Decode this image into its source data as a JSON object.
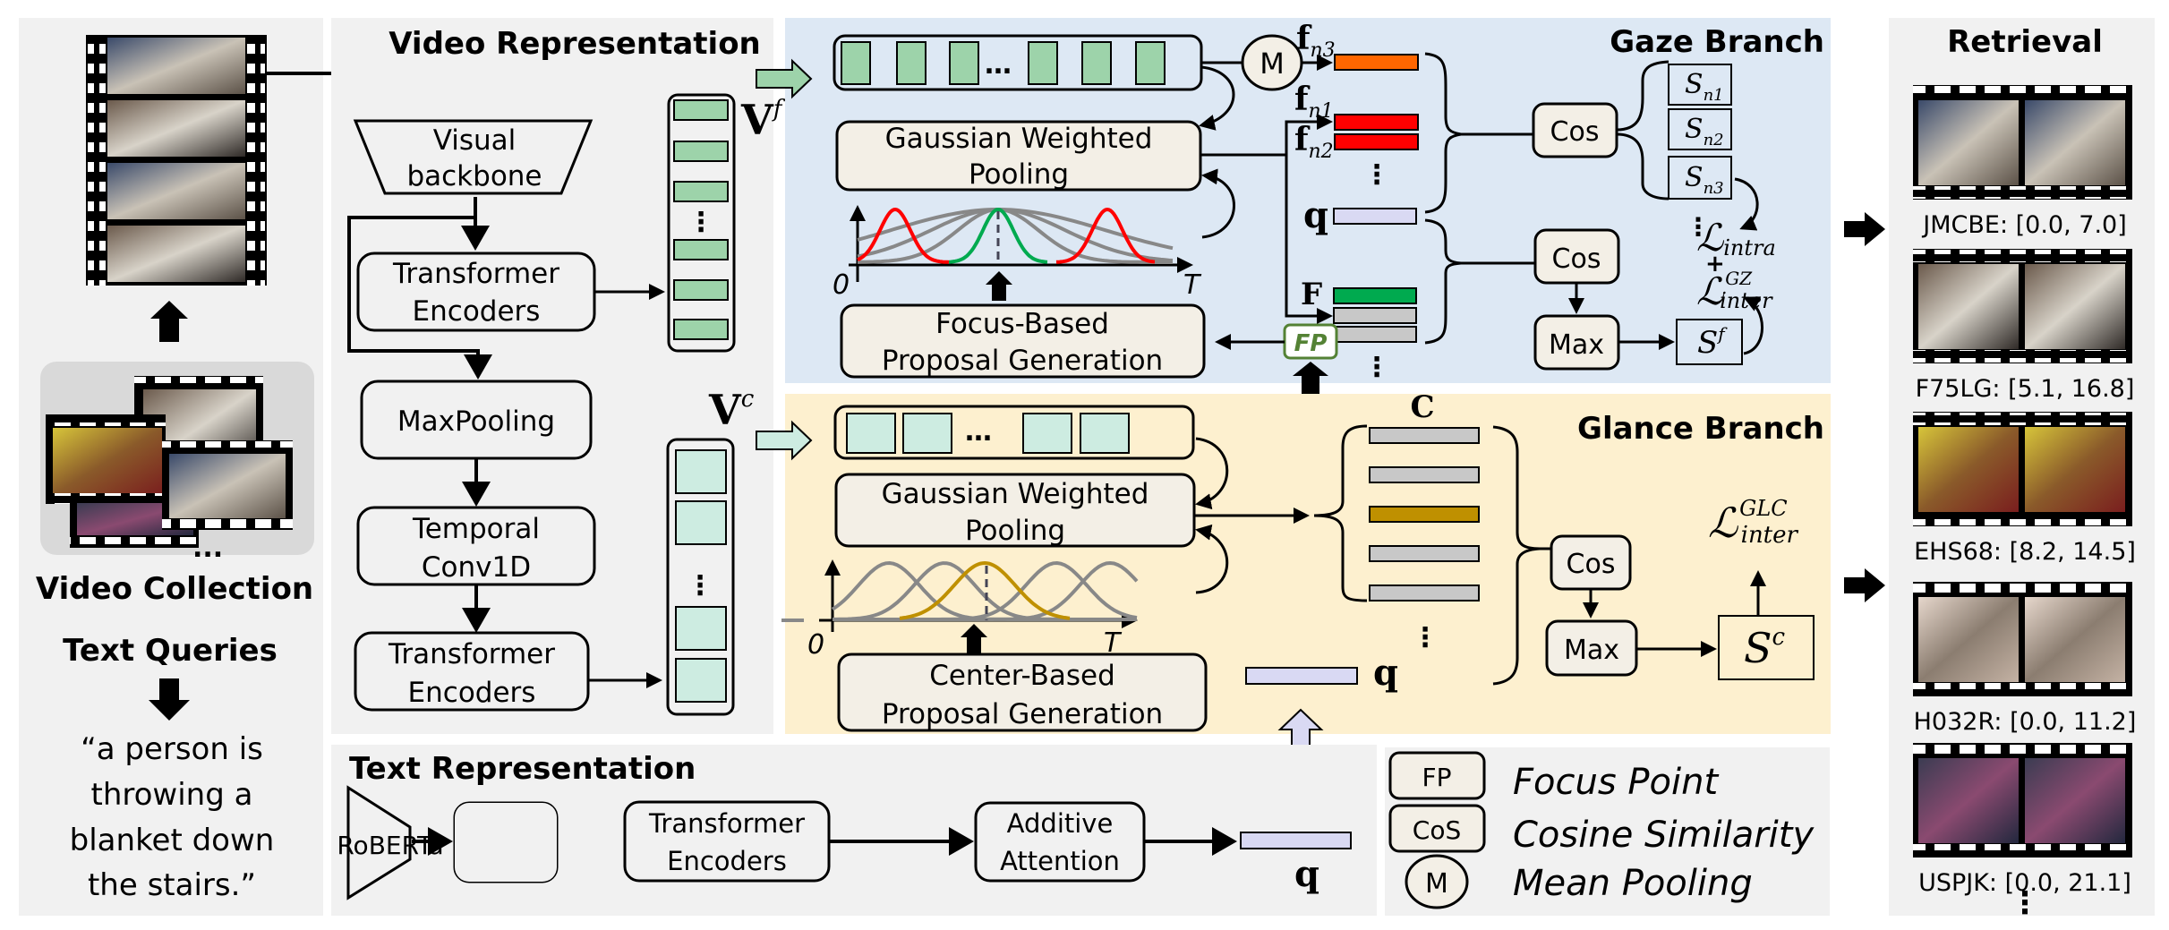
{
  "colors": {
    "panel_gray": "#f1f1f1",
    "gaze_bg": "#dde8f4",
    "glance_bg": "#fdf0cf",
    "feature_green": "#9dd3aa",
    "feature_teal": "#cdece1",
    "query_lavender": "#d9d9f3",
    "red": "#ff0000",
    "orange": "#ff6600",
    "green": "#00aa4f",
    "gray_bar": "#c8c8c8",
    "gold": "#bf9000",
    "fp_green": "#548235"
  },
  "video_collection": {
    "title": "Video Collection",
    "more": "..."
  },
  "text_queries": {
    "title": "Text Queries",
    "query_lines": [
      "“a person is",
      "throwing a",
      "blanket down",
      "the stairs.”"
    ]
  },
  "video_representation": {
    "title": "Video Representation",
    "visual_backbone": [
      "Visual",
      "backbone"
    ],
    "transformer_encoders_1": [
      "Transformer",
      "Encoders"
    ],
    "maxpooling": "MaxPooling",
    "temporal_conv": [
      "Temporal",
      "Conv1D"
    ],
    "transformer_encoders_2": [
      "Transformer",
      "Encoders"
    ],
    "vf_label": "V",
    "vf_sup": "f",
    "vc_label": "V",
    "vc_sup": "c"
  },
  "gaze_branch": {
    "title": "Gaze Branch",
    "gwp": [
      "Gaussian Weighted",
      "Pooling"
    ],
    "proposal": [
      "Focus-Based",
      "Proposal Generation"
    ],
    "axis_origin": "0",
    "axis_end": "T",
    "mean_pool": "M",
    "fn3": "f",
    "fn3_sub": "n3",
    "fn1": "f",
    "fn1_sub": "n1",
    "fn2": "f",
    "fn2_sub": "n2",
    "q": "q",
    "F": "F",
    "fp": "FP",
    "cos1": "Cos",
    "cos2": "Cos",
    "max": "Max",
    "sn1": "S",
    "sn1_sub": "n1",
    "sn2": "S",
    "sn2_sub": "n2",
    "sn3": "S",
    "sn3_sub": "n3",
    "loss_intra": "ℒ",
    "loss_intra_sub": "intra",
    "plus": "+",
    "loss_inter": "ℒ",
    "loss_inter_sup": "GZ",
    "loss_inter_sub": "inter",
    "sf": "S",
    "sf_sup": "f"
  },
  "glance_branch": {
    "title": "Glance Branch",
    "gwp": [
      "Gaussian Weighted",
      "Pooling"
    ],
    "proposal": [
      "Center-Based",
      "Proposal Generation"
    ],
    "axis_origin": "0",
    "axis_end": "T",
    "C": "C",
    "q": "q",
    "cos": "Cos",
    "max": "Max",
    "loss": "ℒ",
    "loss_sup": "GLC",
    "loss_sub": "inter",
    "sc": "S",
    "sc_sup": "c"
  },
  "text_representation": {
    "title": "Text Representation",
    "roberta": "RoBERTa",
    "transformer": [
      "Transformer",
      "Encoders"
    ],
    "additive": [
      "Additive",
      "Attention"
    ],
    "q": "q"
  },
  "legend": {
    "items": [
      {
        "symbol": "FP",
        "label": "Focus Point"
      },
      {
        "symbol": "CoS",
        "label": "Cosine Similarity"
      },
      {
        "symbol": "M",
        "label": "Mean Pooling"
      }
    ]
  },
  "retrieval": {
    "title": "Retrieval",
    "results": [
      {
        "label": "JMCBE: [0.0, 7.0]"
      },
      {
        "label": "F75LG: [5.1, 16.8]"
      },
      {
        "label": "EHS68: [8.2, 14.5]"
      },
      {
        "label": "H032R: [0.0, 11.2]"
      },
      {
        "label": "USPJK: [0.0, 21.1]"
      }
    ],
    "more": "⋮"
  }
}
